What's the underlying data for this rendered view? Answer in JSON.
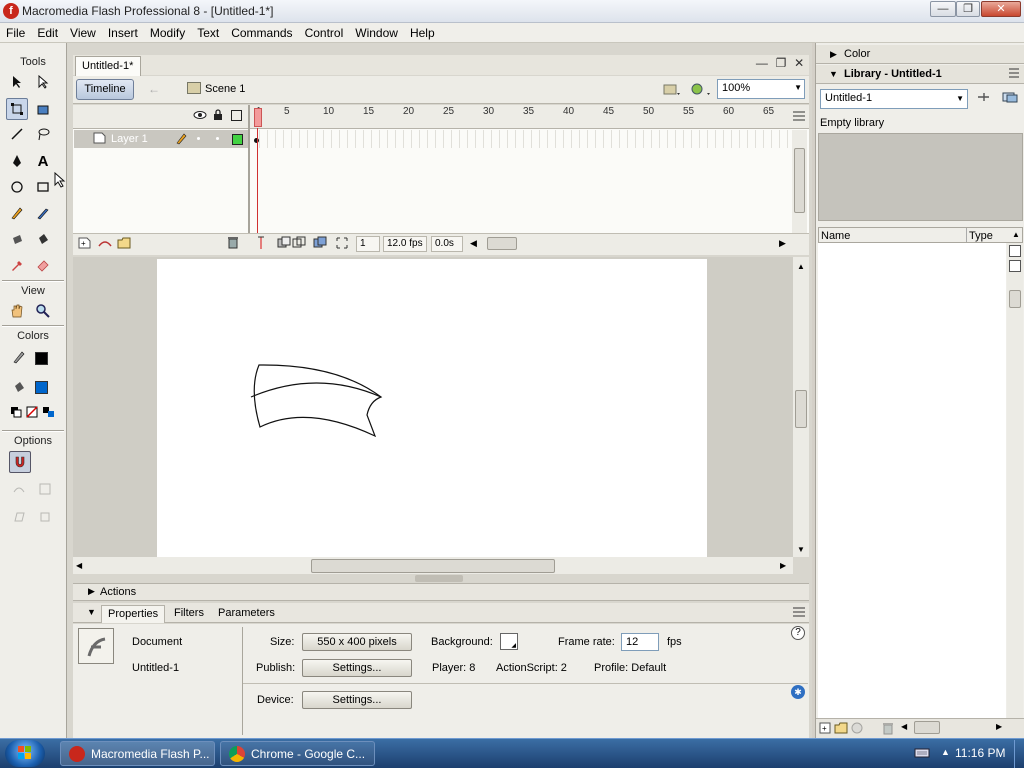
{
  "window": {
    "title": "Macromedia Flash Professional 8 - [Untitled-1*]",
    "app_icon_letter": "f",
    "controls": {
      "minimize": "—",
      "restore": "❐",
      "close": "✕"
    }
  },
  "menubar": [
    "File",
    "Edit",
    "View",
    "Insert",
    "Modify",
    "Text",
    "Commands",
    "Control",
    "Window",
    "Help"
  ],
  "tools": {
    "header": "Tools",
    "view_header": "View",
    "colors_header": "Colors",
    "options_header": "Options",
    "stroke_color": "#000000",
    "fill_color": "#0066cc"
  },
  "document": {
    "tab_label": "Untitled-1*",
    "doc_controls": {
      "minimize": "—",
      "restore": "❐",
      "close": "✕"
    },
    "timeline_button": "Timeline",
    "scene_label": "Scene 1",
    "zoom_value": "100%"
  },
  "timeline": {
    "layer_name": "Layer 1",
    "ruler_ticks": [
      "1",
      "5",
      "10",
      "15",
      "20",
      "25",
      "30",
      "35",
      "40",
      "45",
      "50",
      "55",
      "60",
      "65"
    ],
    "current_frame": "1",
    "frame_rate": "12.0 fps",
    "elapsed_time": "0.0s"
  },
  "panels": {
    "actions_label": "Actions",
    "tabs": [
      "Properties",
      "Filters",
      "Parameters"
    ],
    "properties": {
      "doc_type": "Document",
      "doc_name": "Untitled-1",
      "size_label": "Size:",
      "size_value": "550 x 400 pixels",
      "background_label": "Background:",
      "frame_rate_label": "Frame rate:",
      "frame_rate_value": "12",
      "fps_label": "fps",
      "publish_label": "Publish:",
      "settings_label": "Settings...",
      "player_text": "Player: 8",
      "actionscript_text": "ActionScript: 2",
      "profile_text": "Profile:  Default",
      "device_label": "Device:",
      "device_settings_label": "Settings..."
    }
  },
  "right_panel": {
    "color_header": "Color",
    "library_header": "Library - Untitled-1",
    "library_select": "Untitled-1",
    "library_status": "Empty library",
    "col_name": "Name",
    "col_type": "Type"
  },
  "taskbar": {
    "items": [
      {
        "label": "Macromedia Flash P...",
        "icon": "flash-icon"
      },
      {
        "label": "Chrome - Google C...",
        "icon": "chrome-icon"
      }
    ],
    "clock": "11:16 PM"
  },
  "colors": {
    "accent": "#316ac5",
    "flash_red": "#c8271c"
  }
}
